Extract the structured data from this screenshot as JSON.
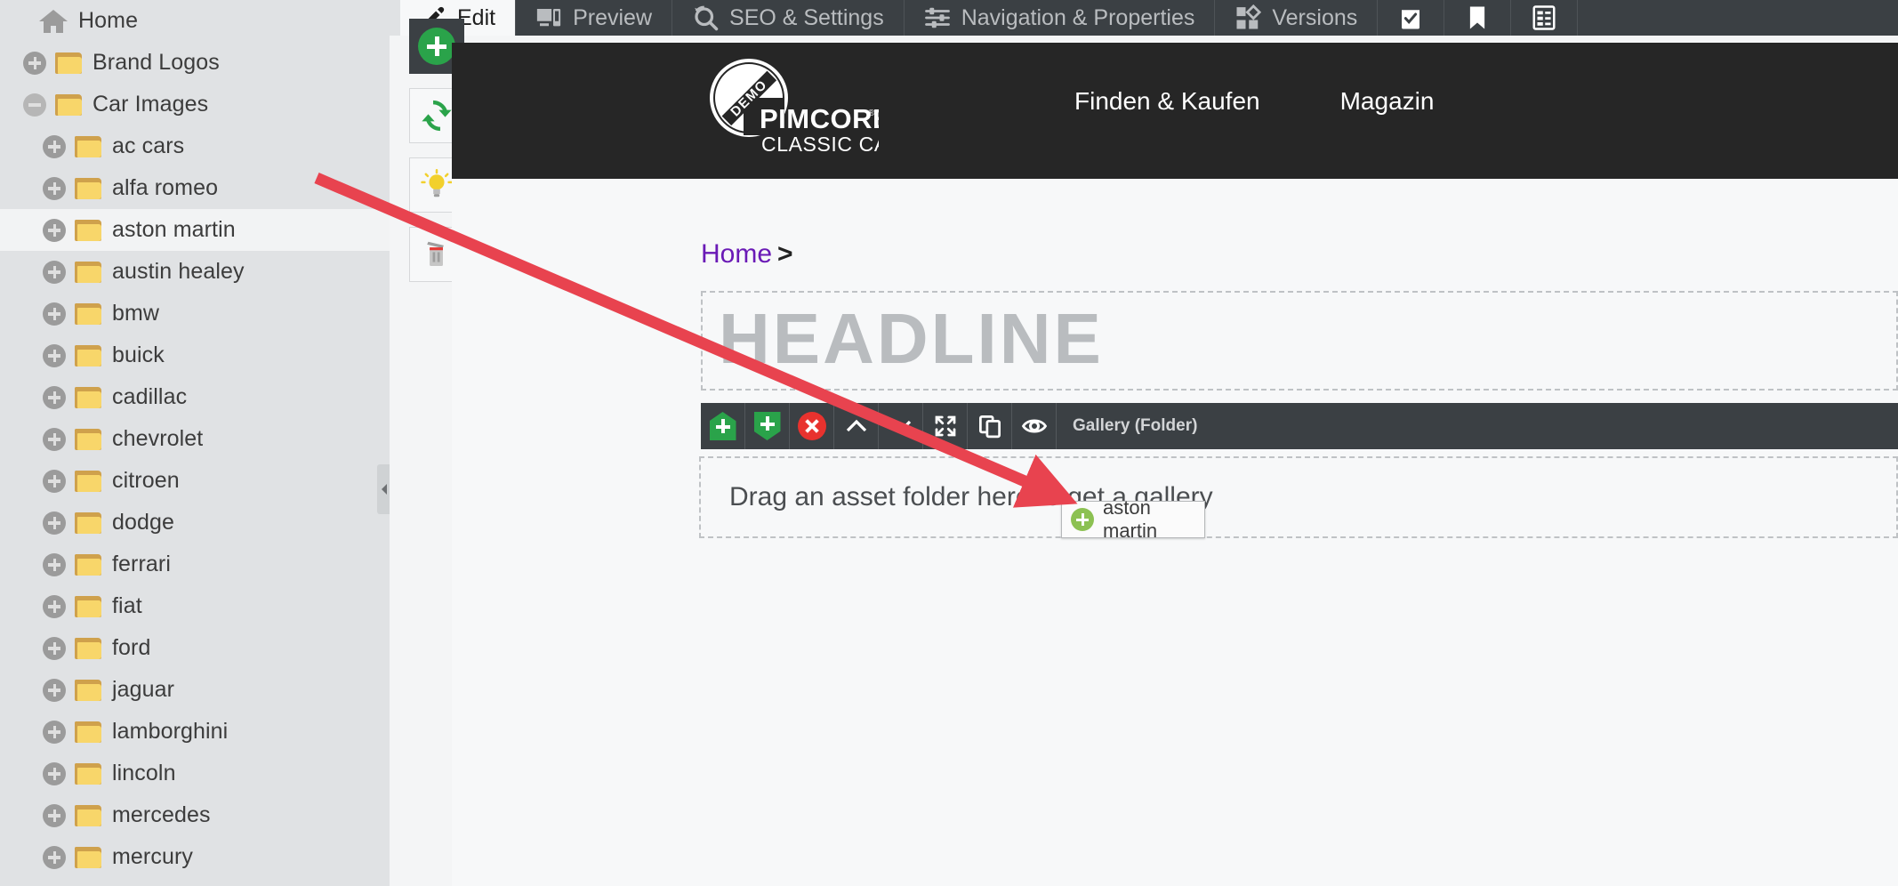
{
  "tree": {
    "root": {
      "label": "Home",
      "icon": "home-icon"
    },
    "items": [
      {
        "label": "Brand Logos",
        "indent": 1,
        "expander": "plus",
        "selected": false
      },
      {
        "label": "Car Images",
        "indent": 1,
        "expander": "minus",
        "selected": false
      },
      {
        "label": "ac cars",
        "indent": 2,
        "expander": "plus",
        "selected": false
      },
      {
        "label": "alfa romeo",
        "indent": 2,
        "expander": "plus",
        "selected": false
      },
      {
        "label": "aston martin",
        "indent": 2,
        "expander": "plus",
        "selected": true
      },
      {
        "label": "austin healey",
        "indent": 2,
        "expander": "plus",
        "selected": false
      },
      {
        "label": "bmw",
        "indent": 2,
        "expander": "plus",
        "selected": false
      },
      {
        "label": "buick",
        "indent": 2,
        "expander": "plus",
        "selected": false
      },
      {
        "label": "cadillac",
        "indent": 2,
        "expander": "plus",
        "selected": false
      },
      {
        "label": "chevrolet",
        "indent": 2,
        "expander": "plus",
        "selected": false
      },
      {
        "label": "citroen",
        "indent": 2,
        "expander": "plus",
        "selected": false
      },
      {
        "label": "dodge",
        "indent": 2,
        "expander": "plus",
        "selected": false
      },
      {
        "label": "ferrari",
        "indent": 2,
        "expander": "plus",
        "selected": false
      },
      {
        "label": "fiat",
        "indent": 2,
        "expander": "plus",
        "selected": false
      },
      {
        "label": "ford",
        "indent": 2,
        "expander": "plus",
        "selected": false
      },
      {
        "label": "jaguar",
        "indent": 2,
        "expander": "plus",
        "selected": false
      },
      {
        "label": "lamborghini",
        "indent": 2,
        "expander": "plus",
        "selected": false
      },
      {
        "label": "lincoln",
        "indent": 2,
        "expander": "plus",
        "selected": false
      },
      {
        "label": "mercedes",
        "indent": 2,
        "expander": "plus",
        "selected": false
      },
      {
        "label": "mercury",
        "indent": 2,
        "expander": "plus",
        "selected": false
      }
    ]
  },
  "tabs": [
    {
      "label": "Edit",
      "icon": "pencil-icon",
      "active": true
    },
    {
      "label": "Preview",
      "icon": "devices-icon",
      "active": false
    },
    {
      "label": "SEO & Settings",
      "icon": "seo-search-icon",
      "active": false
    },
    {
      "label": "Navigation & Properties",
      "icon": "sliders-icon",
      "active": false
    },
    {
      "label": "Versions",
      "icon": "versions-icon",
      "active": false
    },
    {
      "label": "",
      "icon": "tasks-check-icon",
      "active": false
    },
    {
      "label": "",
      "icon": "bookmark-icon",
      "active": false
    },
    {
      "label": "",
      "icon": "list-detail-icon",
      "active": false
    }
  ],
  "vtoolbar": [
    {
      "name": "add-button",
      "icon": "circle-plus-icon",
      "style": "dark"
    },
    {
      "name": "reload-button",
      "icon": "refresh-icon",
      "style": "light"
    },
    {
      "name": "hints-button",
      "icon": "lightbulb-icon",
      "style": "light"
    },
    {
      "name": "delete-button",
      "icon": "trash-icon",
      "style": "light"
    }
  ],
  "site": {
    "logo": {
      "badge": "DEMO",
      "brand": "PIMCORE",
      "registered": "®",
      "tagline": "CLASSIC CARS"
    },
    "nav": [
      "Finden & Kaufen",
      "Magazin"
    ]
  },
  "page": {
    "breadcrumb": {
      "home": "Home",
      "separator": ">"
    },
    "headline_placeholder": "HEADLINE",
    "gallery_toolbar_label": "Gallery (Folder)",
    "gallery_toolbar_buttons": [
      "add-above-icon",
      "add-below-icon",
      "remove-icon",
      "move-up-icon",
      "move-down-icon",
      "fullscreen-icon",
      "copy-icon",
      "visibility-icon"
    ],
    "dropzone_text": "Drag an asset folder here to get a gallery"
  },
  "drag_ghost": {
    "label": "aston martin",
    "icon": "circle-plus-icon"
  },
  "colors": {
    "tab_bar": "#3b4044",
    "site_header": "#262626",
    "accent_green": "#2aa34a",
    "accent_red": "#e8322e",
    "link_purple": "#6a1ab6",
    "folder_yellow": "#f8d66a",
    "annotation_red": "#e8434f"
  }
}
